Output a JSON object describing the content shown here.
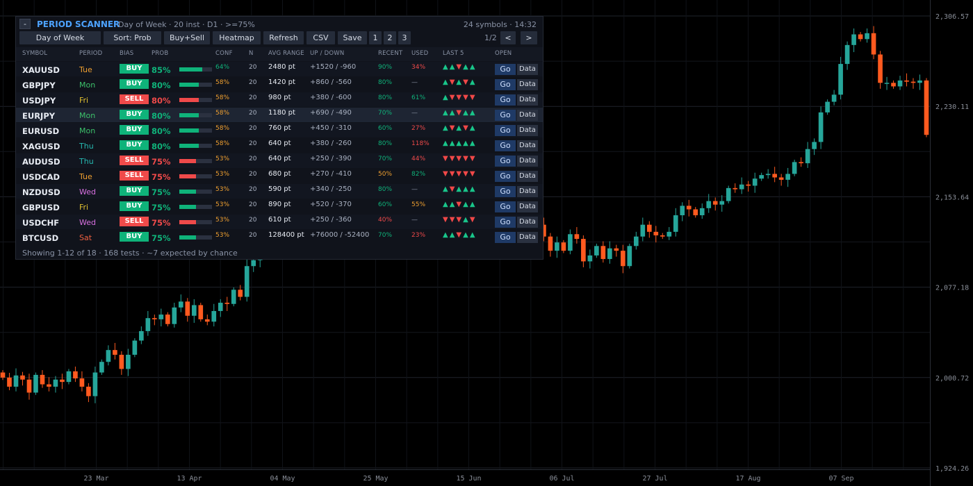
{
  "chart_data": {
    "type": "candlestick",
    "y_ticks": [
      "2,306.57",
      "2,230.11",
      "2,153.64",
      "2,077.18",
      "2,000.72",
      "1,924.26"
    ],
    "y_tick_values": [
      2306.57,
      2230.11,
      2153.64,
      2077.18,
      2000.72,
      1924.26
    ],
    "x_ticks": [
      "23 Mar",
      "13 Apr",
      "04 May",
      "25 May",
      "15 Jun",
      "06 Jul",
      "27 Jul",
      "17 Aug",
      "07 Sep"
    ],
    "ylim": [
      1924.26,
      2306.57
    ],
    "grid": true,
    "colors": {
      "up": "#26a69a",
      "down": "#ff5a1f",
      "grid": "#1f232b",
      "axis_text": "#8a8f99"
    },
    "closes": [
      2000.7,
      1993.0,
      2002.5,
      1999.0,
      1988.0,
      2003.0,
      1995.0,
      1993.0,
      1999.0,
      1997.0,
      2006.0,
      2000.0,
      1993.0,
      1985.0,
      2005.0,
      2014.0,
      2024.0,
      2020.0,
      2008.0,
      2020.0,
      2032.0,
      2040.0,
      2051.0,
      2050.0,
      2054.0,
      2046.0,
      2060.0,
      2065.0,
      2053.0,
      2062.0,
      2050.0,
      2048.0,
      2057.0,
      2064.0,
      2063.0,
      2075.0,
      2069.0,
      2095.0,
      2100.0,
      2105.0,
      2108.0,
      2125.0,
      2138.0,
      2145.0,
      2150.0,
      2143.0,
      2155.0,
      2160.0,
      2158.0,
      2150.0,
      2163.0,
      2168.0,
      2172.0,
      2164.0,
      2158.0,
      2166.0,
      2178.0,
      2175.0,
      2160.0,
      2148.0,
      2150.0,
      2160.0,
      2153.0,
      2145.0,
      2150.0,
      2149.0,
      2162.0,
      2159.0,
      2164.0,
      2147.0,
      2160.0,
      2158.0,
      2172.0,
      2175.0,
      2190.0,
      2181.0,
      2162.0,
      2155.0,
      2140.0,
      2150.0,
      2140.0,
      2130.0,
      2120.0,
      2108.0,
      2115.0,
      2108.0,
      2122.0,
      2118.0,
      2099.0,
      2104.0,
      2112.0,
      2101.0,
      2110.0,
      2108.0,
      2095.0,
      2112.0,
      2120.0,
      2130.0,
      2124.0,
      2121.0,
      2120.0,
      2124.0,
      2138.0,
      2146.0,
      2143.0,
      2138.0,
      2144.0,
      2150.0,
      2147.0,
      2150.0,
      2161.0,
      2160.0,
      2164.0,
      2163.0,
      2169.0,
      2172.0,
      2173.0,
      2170.0,
      2168.0,
      2173.0,
      2183.0,
      2182.0,
      2194.0,
      2200.0,
      2225.0,
      2234.0,
      2240.0,
      2266.0,
      2282.0,
      2291.0,
      2287.0,
      2292.0,
      2274.0,
      2250.0,
      2250.0,
      2247.0,
      2252.0,
      2251.0,
      2250.0,
      2252.0,
      2206.0
    ]
  },
  "scanner": {
    "collapse_symbol": "-",
    "title": "PERIOD SCANNER",
    "subtitle": "Day of Week · 20 inst · D1 · >=75%",
    "status": "24 symbols · 14:32",
    "toolbar": {
      "mode": "Day of Week",
      "sort": "Sort: Prob",
      "filter": "Buy+Sell",
      "heatmap": "Heatmap",
      "refresh": "Refresh",
      "csv": "CSV",
      "save": "Save",
      "page1": "1",
      "page2": "2",
      "page3": "3",
      "pager": "1/2",
      "prev": "<",
      "next": ">"
    },
    "columns": {
      "symbol": "SYMBOL",
      "period": "PERIOD",
      "bias": "BIAS",
      "prob": "PROB",
      "conf": "CONF",
      "n": "N",
      "avg_range": "AVG RANGE",
      "updown": "UP / DOWN",
      "recent": "RECENT",
      "used": "USED",
      "last5": "LAST 5",
      "open": "OPEN"
    },
    "go_label": "Go",
    "data_label": "Data",
    "rows": [
      {
        "symbol": "XAUUSD",
        "period": "Tue",
        "bias": "BUY",
        "prob": "85%",
        "prob_value": 85,
        "conf": "64%",
        "n": "20",
        "avg": "2480 pt",
        "updown": "+1520 / -960",
        "recent": "90%",
        "used": "34%",
        "last5": "▲▲▼▲▲"
      },
      {
        "symbol": "GBPJPY",
        "period": "Mon",
        "bias": "BUY",
        "prob": "80%",
        "prob_value": 80,
        "conf": "58%",
        "n": "20",
        "avg": "1420 pt",
        "updown": "+860 / -560",
        "recent": "80%",
        "used": "—",
        "last5": "▲▼▲▼▲"
      },
      {
        "symbol": "USDJPY",
        "period": "Fri",
        "bias": "SELL",
        "prob": "80%",
        "prob_value": 80,
        "conf": "58%",
        "n": "20",
        "avg": "980 pt",
        "updown": "+380 / -600",
        "recent": "80%",
        "used": "61%",
        "last5": "▲▼▼▼▼"
      },
      {
        "symbol": "EURJPY",
        "period": "Mon",
        "bias": "BUY",
        "prob": "80%",
        "prob_value": 80,
        "conf": "58%",
        "n": "20",
        "avg": "1180 pt",
        "updown": "+690 / -490",
        "recent": "70%",
        "used": "—",
        "last5": "▲▲▼▲▲"
      },
      {
        "symbol": "EURUSD",
        "period": "Mon",
        "bias": "BUY",
        "prob": "80%",
        "prob_value": 80,
        "conf": "58%",
        "n": "20",
        "avg": "760 pt",
        "updown": "+450 / -310",
        "recent": "60%",
        "used": "27%",
        "last5": "▲▼▲▼▲"
      },
      {
        "symbol": "XAGUSD",
        "period": "Thu",
        "bias": "BUY",
        "prob": "80%",
        "prob_value": 80,
        "conf": "58%",
        "n": "20",
        "avg": "640 pt",
        "updown": "+380 / -260",
        "recent": "80%",
        "used": "118%",
        "last5": "▲▲▲▲▲"
      },
      {
        "symbol": "AUDUSD",
        "period": "Thu",
        "bias": "SELL",
        "prob": "75%",
        "prob_value": 75,
        "conf": "53%",
        "n": "20",
        "avg": "640 pt",
        "updown": "+250 / -390",
        "recent": "70%",
        "used": "44%",
        "last5": "▼▼▼▼▼"
      },
      {
        "symbol": "USDCAD",
        "period": "Tue",
        "bias": "SELL",
        "prob": "75%",
        "prob_value": 75,
        "conf": "53%",
        "n": "20",
        "avg": "680 pt",
        "updown": "+270 / -410",
        "recent": "50%",
        "used": "82%",
        "last5": "▼▼▼▼▼"
      },
      {
        "symbol": "NZDUSD",
        "period": "Wed",
        "bias": "BUY",
        "prob": "75%",
        "prob_value": 75,
        "conf": "53%",
        "n": "20",
        "avg": "590 pt",
        "updown": "+340 / -250",
        "recent": "80%",
        "used": "—",
        "last5": "▲▼▲▲▲"
      },
      {
        "symbol": "GBPUSD",
        "period": "Fri",
        "bias": "BUY",
        "prob": "75%",
        "prob_value": 75,
        "conf": "53%",
        "n": "20",
        "avg": "890 pt",
        "updown": "+520 / -370",
        "recent": "60%",
        "used": "55%",
        "last5": "▲▲▼▲▲"
      },
      {
        "symbol": "USDCHF",
        "period": "Wed",
        "bias": "SELL",
        "prob": "75%",
        "prob_value": 75,
        "conf": "53%",
        "n": "20",
        "avg": "610 pt",
        "updown": "+250 / -360",
        "recent": "40%",
        "used": "—",
        "last5": "▼▼▼▲▼"
      },
      {
        "symbol": "BTCUSD",
        "period": "Sat",
        "bias": "BUY",
        "prob": "75%",
        "prob_value": 75,
        "conf": "53%",
        "n": "20",
        "avg": "128400 pt",
        "updown": "+76000 / -52400",
        "recent": "70%",
        "used": "23%",
        "last5": "▲▲▼▲▲"
      }
    ],
    "footer": "Showing 1-12 of 18  ·  168 tests  ·  ~7 expected by chance",
    "colors": {
      "title": "#4da3ff",
      "buy": "#0fb37a",
      "sell": "#ef4a4a",
      "amber": "#f0a030",
      "up_arrow": "#19c58a",
      "down_arrow": "#f04848",
      "mon": "#3cc06a",
      "tue": "#f0a030",
      "wed": "#d870e0",
      "thu": "#26b8b0",
      "fri": "#e0c030",
      "sat": "#ef6040"
    }
  }
}
